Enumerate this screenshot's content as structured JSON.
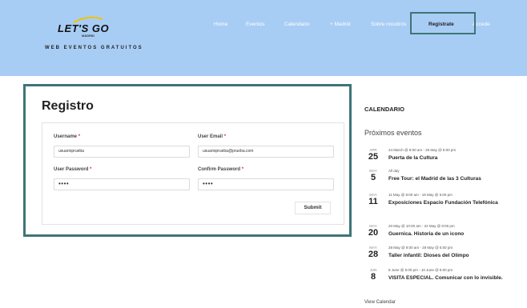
{
  "header": {
    "logo_text": "LET'S GO",
    "logo_sub": "MADRID",
    "tagline": "WEB EVENTOS GRATUITOS",
    "nav": [
      "Home",
      "Eventos",
      "Calendario",
      "+ Madrid",
      "Sobre nosotros",
      "Registrate",
      "Accede"
    ],
    "active_nav": "Registrate"
  },
  "registro": {
    "title": "Registro",
    "username_label": "Username",
    "username_value": "usuarioprueba",
    "email_label": "User Email",
    "email_value": "usuarioprueba@prueba.com",
    "password_label": "User Password",
    "password_value": "••••",
    "confirm_label": "Confirm Password",
    "confirm_value": "••••",
    "required_mark": "*",
    "submit_label": "Submit"
  },
  "sidebar": {
    "title": "CALENDARIO",
    "subtitle": "Próximos eventos",
    "events": [
      {
        "month": "APR",
        "day": "25",
        "time": "24 March @ 8:00 am - 26 May @ 5:00 pm",
        "title": "Puerta de la Cultura"
      },
      {
        "month": "MAY",
        "day": "5",
        "time": "All day",
        "title": "Free Tour: el Madrid de las 3 Culturas"
      },
      {
        "month": "MAY",
        "day": "11",
        "time": "11 May @ 8:00 am - 18 May @ 5:00 pm",
        "title": "Exposiciones Espacio Fundación Telefónica"
      },
      {
        "month": "MAY",
        "day": "20",
        "time": "20 May @ 10:00 am - 22 May @ 8:00 pm",
        "title": "Guernica. Historia de un icono"
      },
      {
        "month": "MAY",
        "day": "28",
        "time": "28 May @ 8:00 am - 29 May @ 5:00 pm",
        "title": "Taller infantil: Dioses del Olimpo"
      },
      {
        "month": "JUN",
        "day": "8",
        "time": "8 June @ 5:00 pm - 10 June @ 5:00 pm",
        "title": "VISITA ESPECIAL. Comunicar con lo invisible."
      }
    ],
    "view_calendar": "View Calendar"
  },
  "colors": {
    "header_bg": "#a8cdf5",
    "frame": "#3f7478",
    "required": "#dd3333"
  }
}
